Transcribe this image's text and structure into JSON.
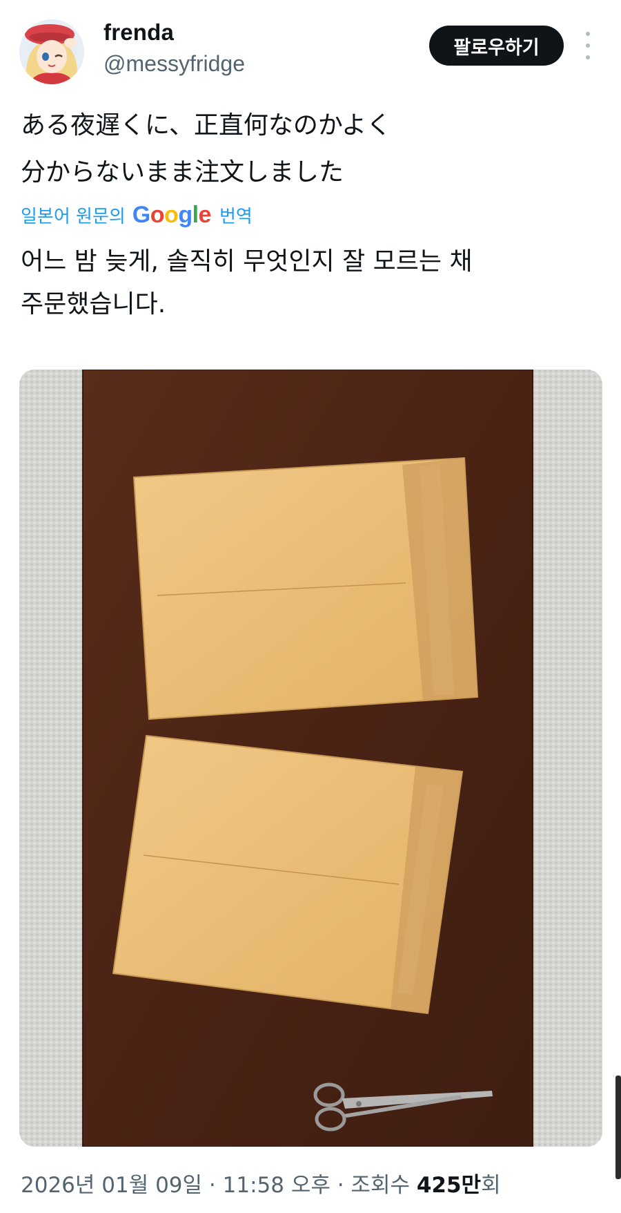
{
  "author": {
    "display_name": "frenda",
    "handle": "@messyfridge",
    "follow_label": "팔로우하기",
    "avatar_icon": "anime-avatar-icon",
    "more_icon": "more-vertical-icon"
  },
  "tweet": {
    "text": "ある夜遅くに、正直何なのかよく\n分からないまま注文しました",
    "translate_prefix": "일본어 원문의",
    "translate_brand": "Google",
    "translate_suffix": "번역",
    "translated_text": "어느 밤 늦게, 솔직히 무엇인지 잘 모르는 채\n주문했습니다."
  },
  "media": {
    "description_icon": "photo-two-envelopes-and-scissors",
    "colors": {
      "carpet": "#d8d8d5",
      "table": "#4f2616",
      "envelope": "#e9bd72",
      "tape": "#c9955a"
    }
  },
  "meta": {
    "date": "2026년 01월 09일",
    "sep1": " · ",
    "time": "11:58 오후",
    "sep2": " · ",
    "views_label": "조회수 ",
    "views_count": "425만",
    "views_unit": "회"
  },
  "colors": {
    "text": "#0f1419",
    "secondary": "#536471",
    "link": "#1d9bf0",
    "button": "#0f1419"
  }
}
